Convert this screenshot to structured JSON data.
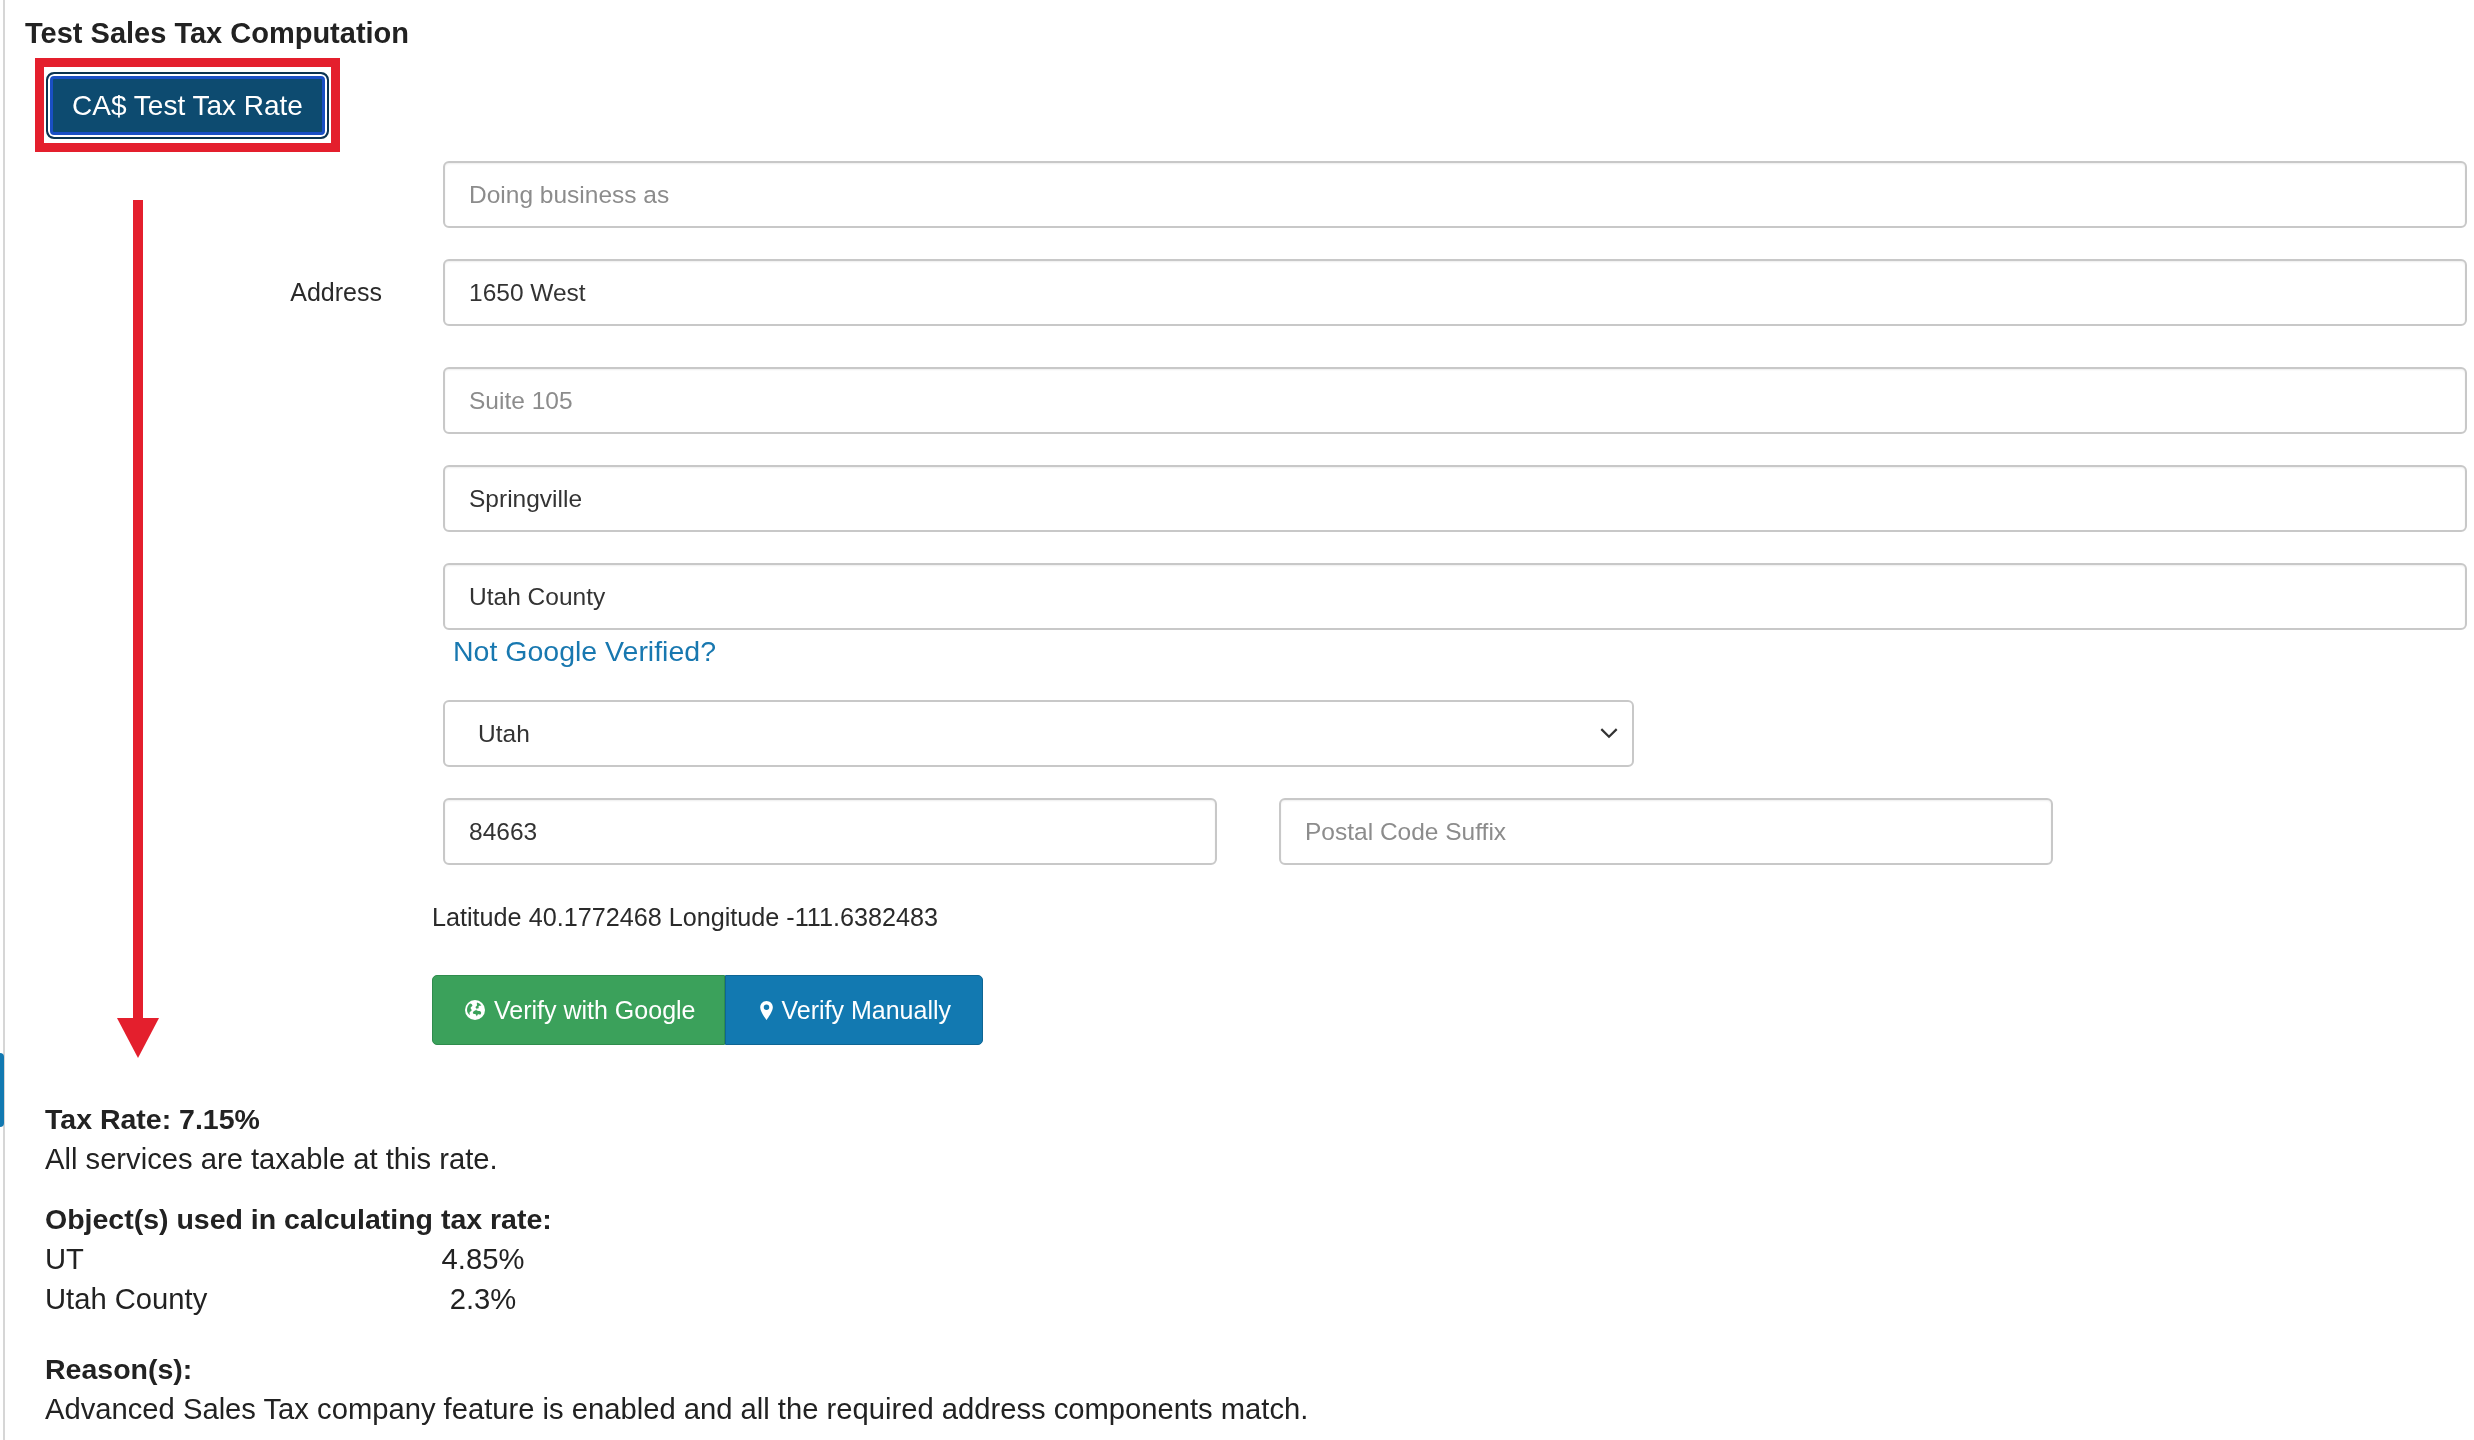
{
  "title": "Test Sales Tax Computation",
  "test_button": {
    "label": "CA$ Test Tax Rate",
    "focused": true
  },
  "address_form": {
    "fields": [
      {
        "placeholder": "Doing business as"
      },
      {
        "label": "Address",
        "value": "1650 West"
      },
      {
        "placeholder": "Suite 105"
      },
      {
        "value": "Springville"
      },
      {
        "value": "Utah County"
      }
    ],
    "verify_link": "Not Google Verified?",
    "state_select": {
      "value": "Utah"
    },
    "postal_code": {
      "value": "84663"
    },
    "postal_code_suffix": {
      "placeholder": "Postal Code Suffix"
    },
    "coordinates": "Latitude 40.1772468 Longitude -111.6382483",
    "buttons": [
      {
        "kind": "google",
        "label": "Verify with Google"
      },
      {
        "kind": "manual",
        "label": "Verify Manually"
      }
    ]
  },
  "result": {
    "tax_rate": "Tax Rate: 7.15%",
    "note": "All services are taxable at this rate.",
    "objects_heading": "Object(s) used in calculating tax rate:",
    "objects": [
      {
        "name": "UT",
        "rate": "4.85%"
      },
      {
        "name": "Utah County",
        "rate": "2.3%"
      }
    ],
    "reasons_heading": "Reason(s):",
    "reason": "Advanced Sales Tax company feature is enabled and all the required address components match."
  }
}
